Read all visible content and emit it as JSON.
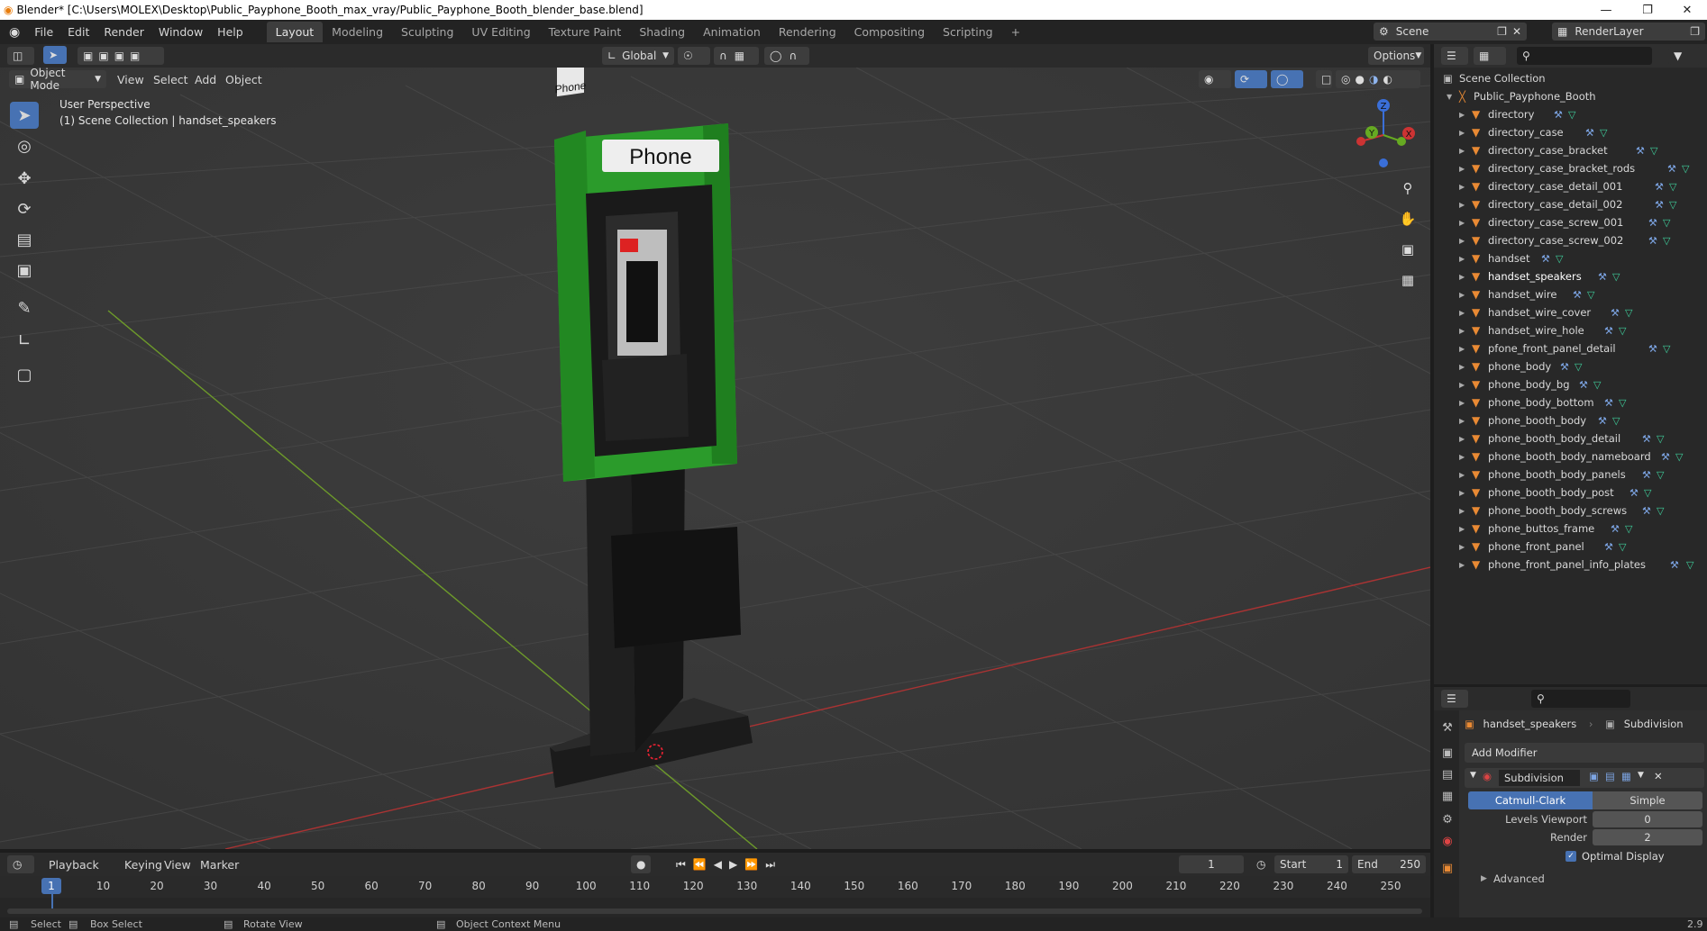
{
  "window": {
    "title": "Blender* [C:\\Users\\MOLEX\\Desktop\\Public_Payphone_Booth_max_vray/Public_Payphone_Booth_blender_base.blend]",
    "minimize": "—",
    "restore": "❐",
    "close": "✕"
  },
  "menu": {
    "items": [
      "File",
      "Edit",
      "Render",
      "Window",
      "Help"
    ]
  },
  "workspaces": {
    "tabs": [
      "Layout",
      "Modeling",
      "Sculpting",
      "UV Editing",
      "Texture Paint",
      "Shading",
      "Animation",
      "Rendering",
      "Compositing",
      "Scripting"
    ],
    "active": "Layout",
    "add": "+"
  },
  "scene": {
    "name": "Scene",
    "render_layer": "RenderLayer"
  },
  "viewport_header": {
    "mode": "Object Mode",
    "menus": [
      "View",
      "Select",
      "Add",
      "Object"
    ],
    "orientation": "Global",
    "options": "Options"
  },
  "viewport": {
    "perspective": "User Perspective",
    "collection_info": "(1) Scene Collection | handset_speakers",
    "sign_text": "Phone",
    "side_sign": "Phone",
    "gizmo": {
      "z": "Z",
      "y": "Y",
      "x": "X"
    }
  },
  "outliner": {
    "root": "Scene Collection",
    "collection": "Public_Payphone_Booth",
    "selected": "handset_speakers",
    "items": [
      "directory",
      "directory_case",
      "directory_case_bracket",
      "directory_case_bracket_rods",
      "directory_case_detail_001",
      "directory_case_detail_002",
      "directory_case_screw_001",
      "directory_case_screw_002",
      "handset",
      "handset_speakers",
      "handset_wire",
      "handset_wire_cover",
      "handset_wire_hole",
      "pfone_front_panel_detail",
      "phone_body",
      "phone_body_bg",
      "phone_body_bottom",
      "phone_booth_body",
      "phone_booth_body_detail",
      "phone_booth_body_nameboard",
      "phone_booth_body_panels",
      "phone_booth_body_post",
      "phone_booth_body_screws",
      "phone_buttos_frame",
      "phone_front_panel",
      "phone_front_panel_info_plates"
    ]
  },
  "properties": {
    "object": "handset_speakers",
    "modifier_context": "Subdivision",
    "add_modifier": "Add Modifier",
    "modifier_name": "Subdivision",
    "algorithms": [
      "Catmull-Clark",
      "Simple"
    ],
    "active_algorithm": "Catmull-Clark",
    "levels_viewport_label": "Levels Viewport",
    "levels_viewport": "0",
    "render_label": "Render",
    "render": "2",
    "optimal_display": "Optimal Display",
    "advanced": "Advanced"
  },
  "timeline": {
    "menus": [
      "Playback",
      "Keying",
      "View",
      "Marker"
    ],
    "current_frame": "1",
    "start_label": "Start",
    "start": "1",
    "end_label": "End",
    "end": "250",
    "ticks": [
      "1",
      "10",
      "20",
      "30",
      "40",
      "50",
      "60",
      "70",
      "80",
      "90",
      "100",
      "110",
      "120",
      "130",
      "140",
      "150",
      "160",
      "170",
      "180",
      "190",
      "200",
      "210",
      "220",
      "230",
      "240",
      "250"
    ]
  },
  "statusbar": {
    "items": [
      "Select",
      "Box Select",
      "Rotate View",
      "Object Context Menu"
    ],
    "version": "2.9"
  }
}
